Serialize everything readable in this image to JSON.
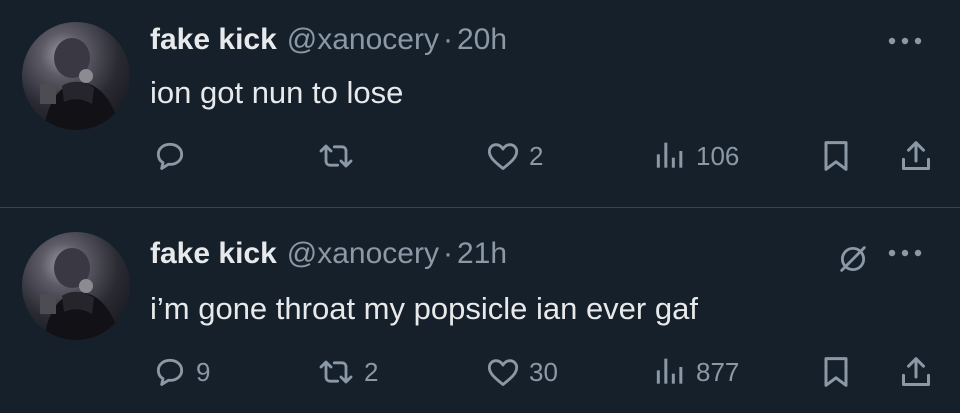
{
  "tweets": [
    {
      "author_name": "fake kick",
      "handle": "@xanocery",
      "separator": "·",
      "time": "20h",
      "text": "ion got nun to lose",
      "replies": "",
      "retweets": "",
      "likes": "2",
      "views": "106",
      "show_grok_icon": false
    },
    {
      "author_name": "fake kick",
      "handle": "@xanocery",
      "separator": "·",
      "time": "21h",
      "text": "i’m gone throat my popsicle ian ever gaf",
      "replies": "9",
      "retweets": "2",
      "likes": "30",
      "views": "877",
      "show_grok_icon": true
    }
  ],
  "icons": {
    "reply": "speech-bubble",
    "retweet": "two-arrows-loop",
    "like": "heart",
    "views": "bar-chart",
    "bookmark": "bookmark",
    "share": "upload-arrow",
    "more": "three-dots",
    "grok": "slashed-circle"
  },
  "colors": {
    "background": "#15202b",
    "primary_text": "#e7e9ea",
    "secondary_text": "#8b98a5",
    "divider": "#38444d"
  }
}
